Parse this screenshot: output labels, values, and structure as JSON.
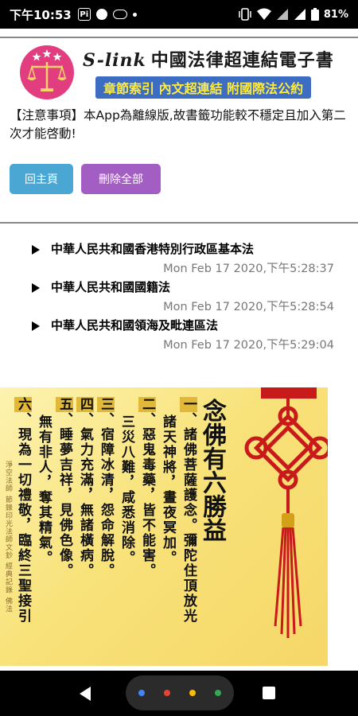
{
  "status_bar": {
    "time": "下午10:53",
    "battery": "81%"
  },
  "header": {
    "brand_prefix": "S-link",
    "brand_title": "中國法律超連結電子書",
    "slogan": "章節索引 內文超連結 附國際法公約",
    "logo_name": "scales-of-justice-logo"
  },
  "notice": "【注意事項】本App為離線版,故書籤功能較不穩定且加入第二次才能啓動!",
  "buttons": {
    "home_label": "回主頁",
    "delete_all_label": "刪除全部"
  },
  "bookmarks": [
    {
      "title": "中華人民共和國香港特別行政區基本法",
      "timestamp": "Mon Feb 17 2020,下午5:28:37"
    },
    {
      "title": "中華人民共和國國籍法",
      "timestamp": "Mon Feb 17 2020,下午5:28:54"
    },
    {
      "title": "中華人民共和國領海及毗連區法",
      "timestamp": "Mon Feb 17 2020,下午5:29:04"
    }
  ],
  "image": {
    "title": "念佛有六勝益",
    "lines": [
      {
        "num": "一",
        "text": "、諸佛菩薩護念。彌陀住頂放光"
      },
      {
        "num": "",
        "text": "諸天神將，晝夜冥加。"
      },
      {
        "num": "二",
        "text": "、惡鬼毒藥，皆不能害。"
      },
      {
        "num": "",
        "text": "三災八難，咸悉消除。"
      },
      {
        "num": "三",
        "text": "、宿障冰清，怨命解脫。"
      },
      {
        "num": "四",
        "text": "、氣力充滿，無諸橫病。"
      },
      {
        "num": "五",
        "text": "、睡夢吉祥，見佛色像。"
      },
      {
        "num": "",
        "text": "無有非人，奪其精氣。"
      },
      {
        "num": "六",
        "text": "、現為一切禮敬，臨終三聖接引"
      }
    ],
    "credit": "淨空法師 節錄印光法師文鈔 經典記錄 佛法"
  },
  "colors": {
    "home_button": "#4aa6d3",
    "delete_button": "#a35ec3",
    "slogan_bg": "#3d6cc3",
    "slogan_text": "#ffeb3b"
  }
}
